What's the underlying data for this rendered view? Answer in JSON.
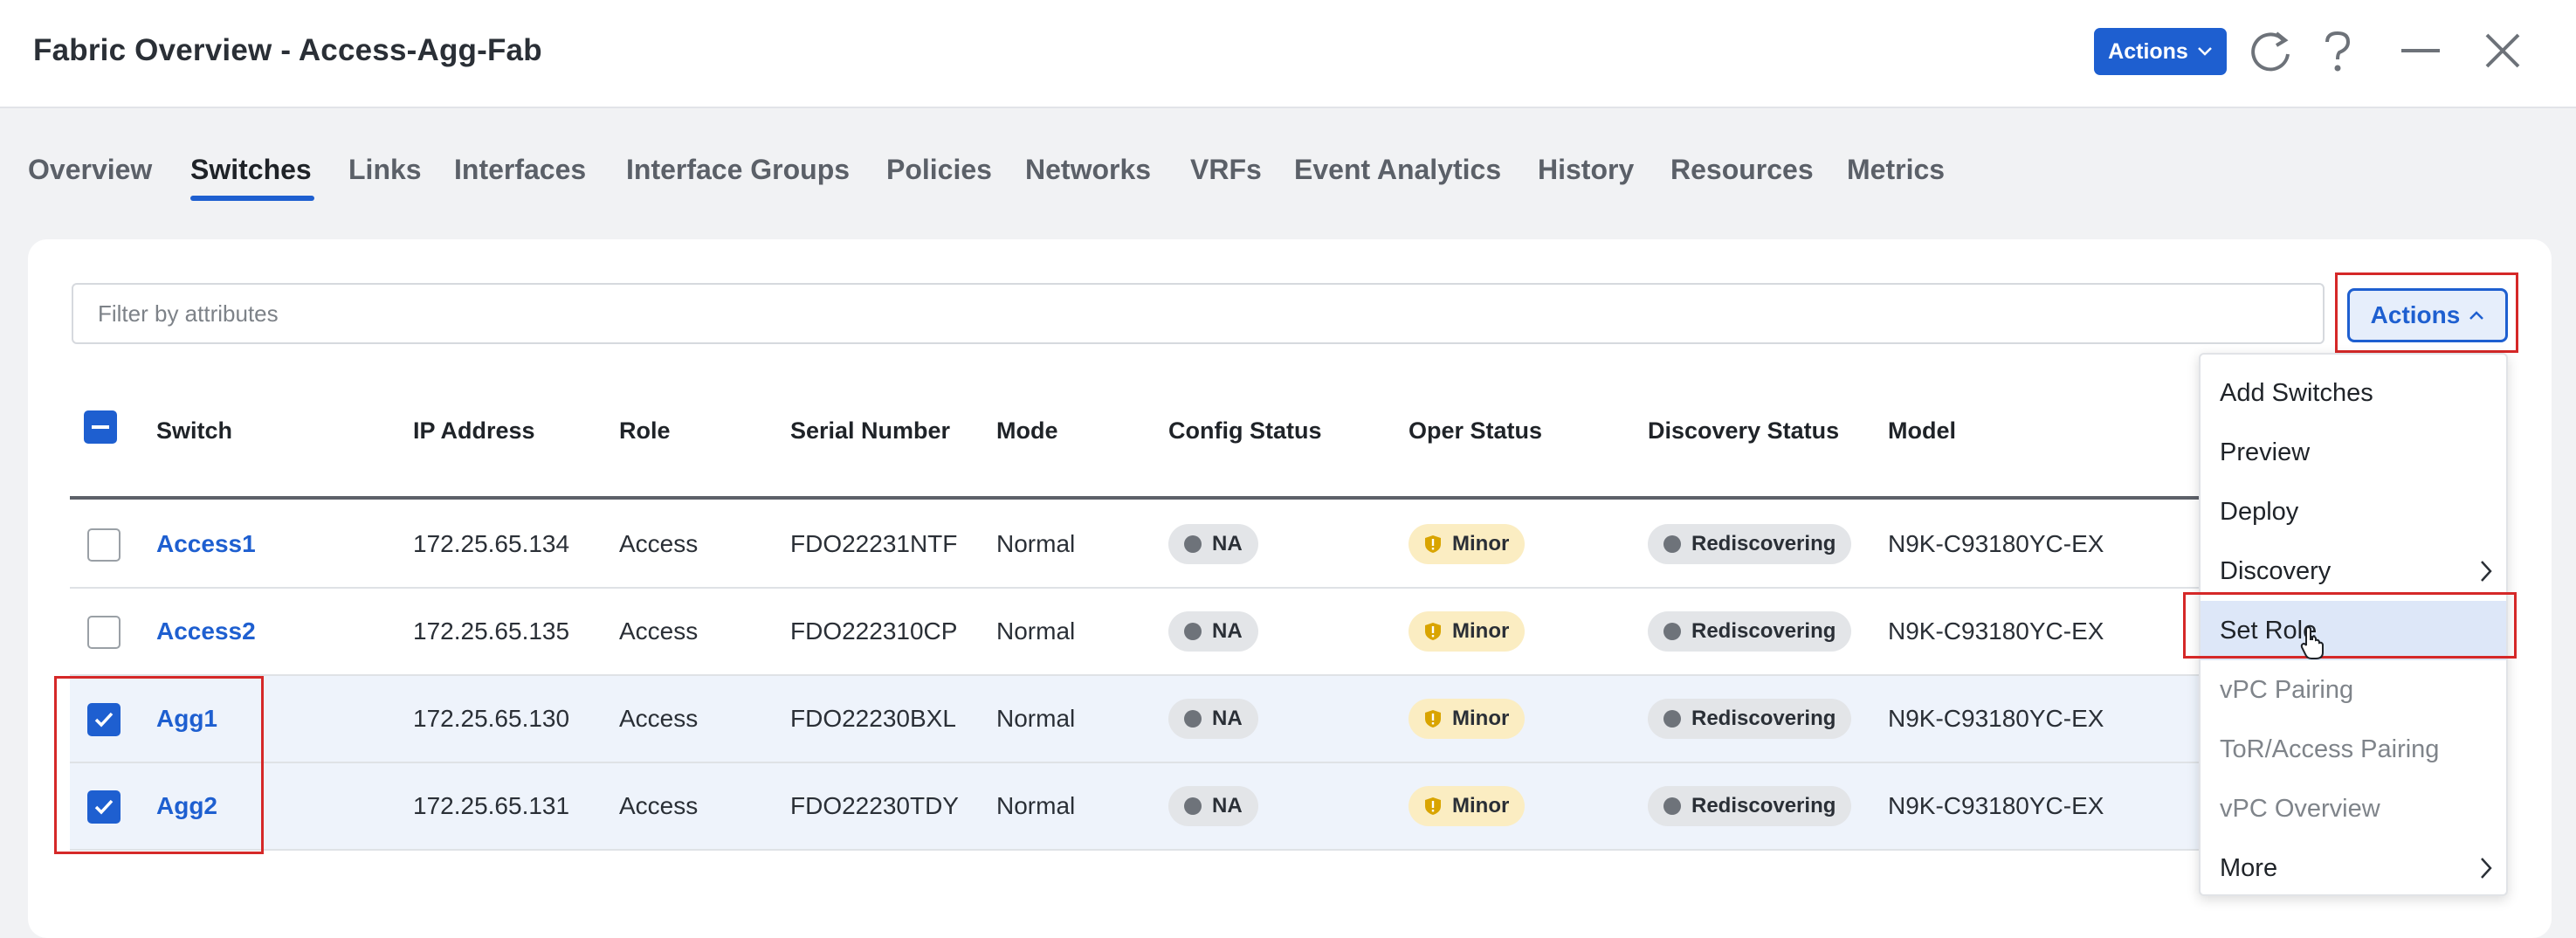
{
  "header": {
    "title": "Fabric Overview - Access-Agg-Fab",
    "actions_label": "Actions",
    "icons": [
      "refresh-icon",
      "help-icon",
      "minimize-icon",
      "close-icon"
    ]
  },
  "tabs": [
    {
      "label": "Overview",
      "active": false
    },
    {
      "label": "Switches",
      "active": true
    },
    {
      "label": "Links",
      "active": false
    },
    {
      "label": "Interfaces",
      "active": false
    },
    {
      "label": "Interface Groups",
      "active": false
    },
    {
      "label": "Policies",
      "active": false
    },
    {
      "label": "Networks",
      "active": false
    },
    {
      "label": "VRFs",
      "active": false
    },
    {
      "label": "Event Analytics",
      "active": false
    },
    {
      "label": "History",
      "active": false
    },
    {
      "label": "Resources",
      "active": false
    },
    {
      "label": "Metrics",
      "active": false
    }
  ],
  "filter": {
    "placeholder": "Filter by attributes",
    "value": ""
  },
  "panel_actions_label": "Actions",
  "table": {
    "columns": [
      "Switch",
      "IP Address",
      "Role",
      "Serial Number",
      "Mode",
      "Config Status",
      "Oper Status",
      "Discovery Status",
      "Model"
    ],
    "rows": [
      {
        "checked": false,
        "switch": "Access1",
        "ip": "172.25.65.134",
        "role": "Access",
        "serial": "FDO22231NTF",
        "mode": "Normal",
        "config": "NA",
        "oper": "Minor",
        "discovery": "Rediscovering",
        "model": "N9K-C93180YC-EX"
      },
      {
        "checked": false,
        "switch": "Access2",
        "ip": "172.25.65.135",
        "role": "Access",
        "serial": "FDO222310CP",
        "mode": "Normal",
        "config": "NA",
        "oper": "Minor",
        "discovery": "Rediscovering",
        "model": "N9K-C93180YC-EX"
      },
      {
        "checked": true,
        "switch": "Agg1",
        "ip": "172.25.65.130",
        "role": "Access",
        "serial": "FDO22230BXL",
        "mode": "Normal",
        "config": "NA",
        "oper": "Minor",
        "discovery": "Rediscovering",
        "model": "N9K-C93180YC-EX"
      },
      {
        "checked": true,
        "switch": "Agg2",
        "ip": "172.25.65.131",
        "role": "Access",
        "serial": "FDO22230TDY",
        "mode": "Normal",
        "config": "NA",
        "oper": "Minor",
        "discovery": "Rediscovering",
        "model": "N9K-C93180YC-EX"
      }
    ]
  },
  "menu": {
    "items": [
      {
        "label": "Add Switches",
        "disabled": false,
        "submenu": false,
        "highlighted": false
      },
      {
        "label": "Preview",
        "disabled": false,
        "submenu": false,
        "highlighted": false
      },
      {
        "label": "Deploy",
        "disabled": false,
        "submenu": false,
        "highlighted": false
      },
      {
        "label": "Discovery",
        "disabled": false,
        "submenu": true,
        "highlighted": false
      },
      {
        "label": "Set Role",
        "disabled": false,
        "submenu": false,
        "highlighted": true
      },
      {
        "label": "vPC Pairing",
        "disabled": true,
        "submenu": false,
        "highlighted": false
      },
      {
        "label": "ToR/Access Pairing",
        "disabled": true,
        "submenu": false,
        "highlighted": false
      },
      {
        "label": "vPC Overview",
        "disabled": true,
        "submenu": false,
        "highlighted": false
      },
      {
        "label": "More",
        "disabled": false,
        "submenu": true,
        "highlighted": false
      }
    ]
  },
  "colors": {
    "accent": "#1e5fd0",
    "highlight_box": "#d52828",
    "minor_pill": "#fbedc2",
    "neutral_pill": "#e3e5e8",
    "selected_row": "#eef3fb"
  }
}
